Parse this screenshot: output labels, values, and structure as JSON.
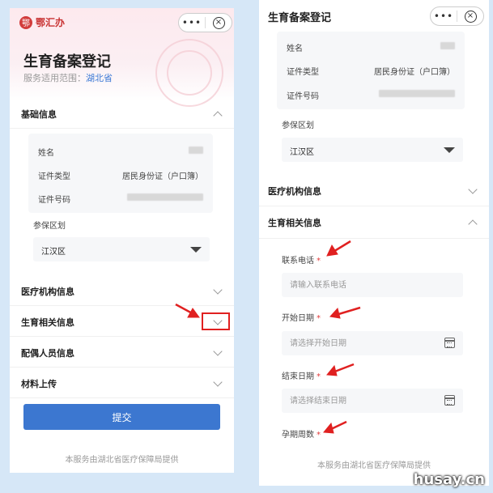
{
  "app": {
    "logo_text": "鄂汇办",
    "more": "•••",
    "close": "×"
  },
  "page": {
    "title": "生育备案登记",
    "scope_label": "服务适用范围：",
    "scope_value": "湖北省"
  },
  "sections": {
    "basic": "基础信息",
    "medical": "医疗机构信息",
    "birth": "生育相关信息",
    "spouse": "配偶人员信息",
    "materials": "材料上传"
  },
  "basic_info": {
    "name_label": "姓名",
    "id_type_label": "证件类型",
    "id_type_value": "居民身份证（户口簿）",
    "id_no_label": "证件号码"
  },
  "insured_area": {
    "label": "参保区划",
    "value": "江汉区"
  },
  "birth_fields": {
    "phone_label": "联系电话",
    "phone_placeholder": "请输入联系电话",
    "start_label": "开始日期",
    "start_placeholder": "请选择开始日期",
    "end_label": "结束日期",
    "end_placeholder": "请选择结束日期",
    "weeks_label": "孕期周数",
    "required_mark": "*"
  },
  "submit_label": "提交",
  "footer": "本服务由湖北省医疗保障局提供",
  "watermark_brand": "husay.cn",
  "colors": {
    "primary": "#3c77d0",
    "required": "#e23a3a",
    "annotation": "#e02020",
    "logo": "#c83232"
  }
}
